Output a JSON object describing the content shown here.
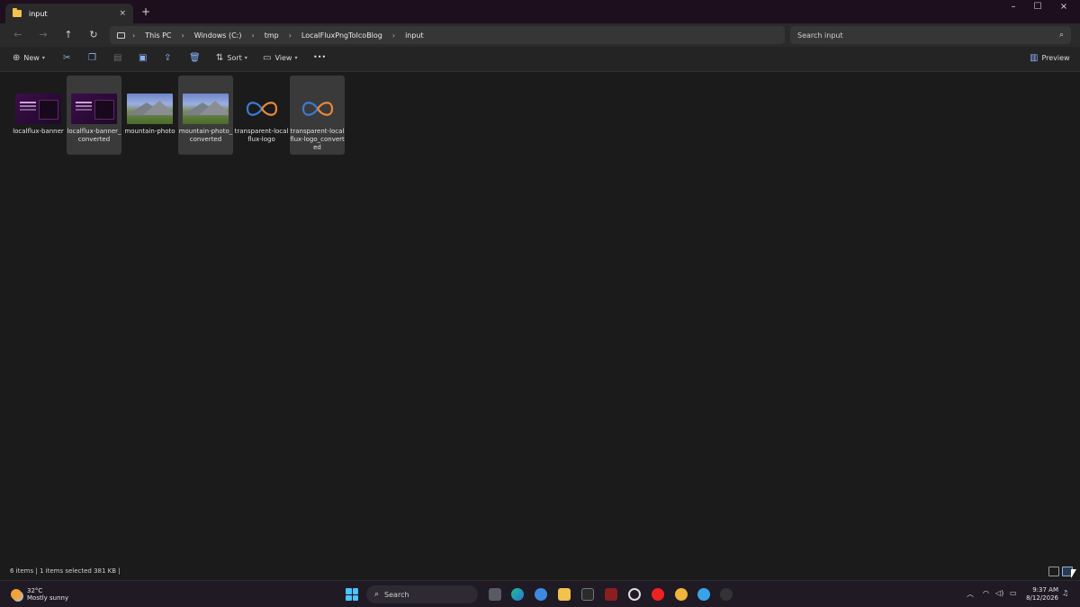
{
  "window": {
    "tab_title": "input",
    "tab_close": "×",
    "new_tab": "+",
    "minimize": "–",
    "maximize": "☐",
    "close": "×"
  },
  "nav": {
    "back": "←",
    "forward": "→",
    "up": "↑",
    "refresh": "↻"
  },
  "breadcrumb": {
    "items": [
      "This PC",
      "Windows (C:)",
      "tmp",
      "LocalFluxPngToIcoBlog",
      "input"
    ],
    "separator": "›"
  },
  "search": {
    "placeholder": "Search input",
    "icon": "⌕"
  },
  "commands": {
    "new_label": "New",
    "sort_label": "Sort",
    "view_label": "View",
    "more": "•••",
    "preview_label": "Preview"
  },
  "files": [
    {
      "name": "localflux-banner",
      "type": "banner",
      "selected": false
    },
    {
      "name": "localflux-banner_converted",
      "type": "banner",
      "selected": true
    },
    {
      "name": "mountain-photo",
      "type": "mountain",
      "selected": false
    },
    {
      "name": "mountain-photo_converted",
      "type": "mountain",
      "selected": true
    },
    {
      "name": "transparent-localflux-logo",
      "type": "logo",
      "selected": false
    },
    {
      "name": "transparent-localflux-logo_converted",
      "type": "logo",
      "selected": true
    }
  ],
  "status": {
    "text": "6 items  |   1 items selected  381 KB  |"
  },
  "taskbar": {
    "temperature": "32°C",
    "condition": "Mostly sunny",
    "search_placeholder": "Search",
    "time": "9:37 AM",
    "date": "8/12/2026"
  },
  "colors": {
    "accent": "#8ab4f8",
    "folder": "#f2c14e",
    "logo_blue": "#3a7bd5",
    "logo_orange": "#e8893a"
  }
}
